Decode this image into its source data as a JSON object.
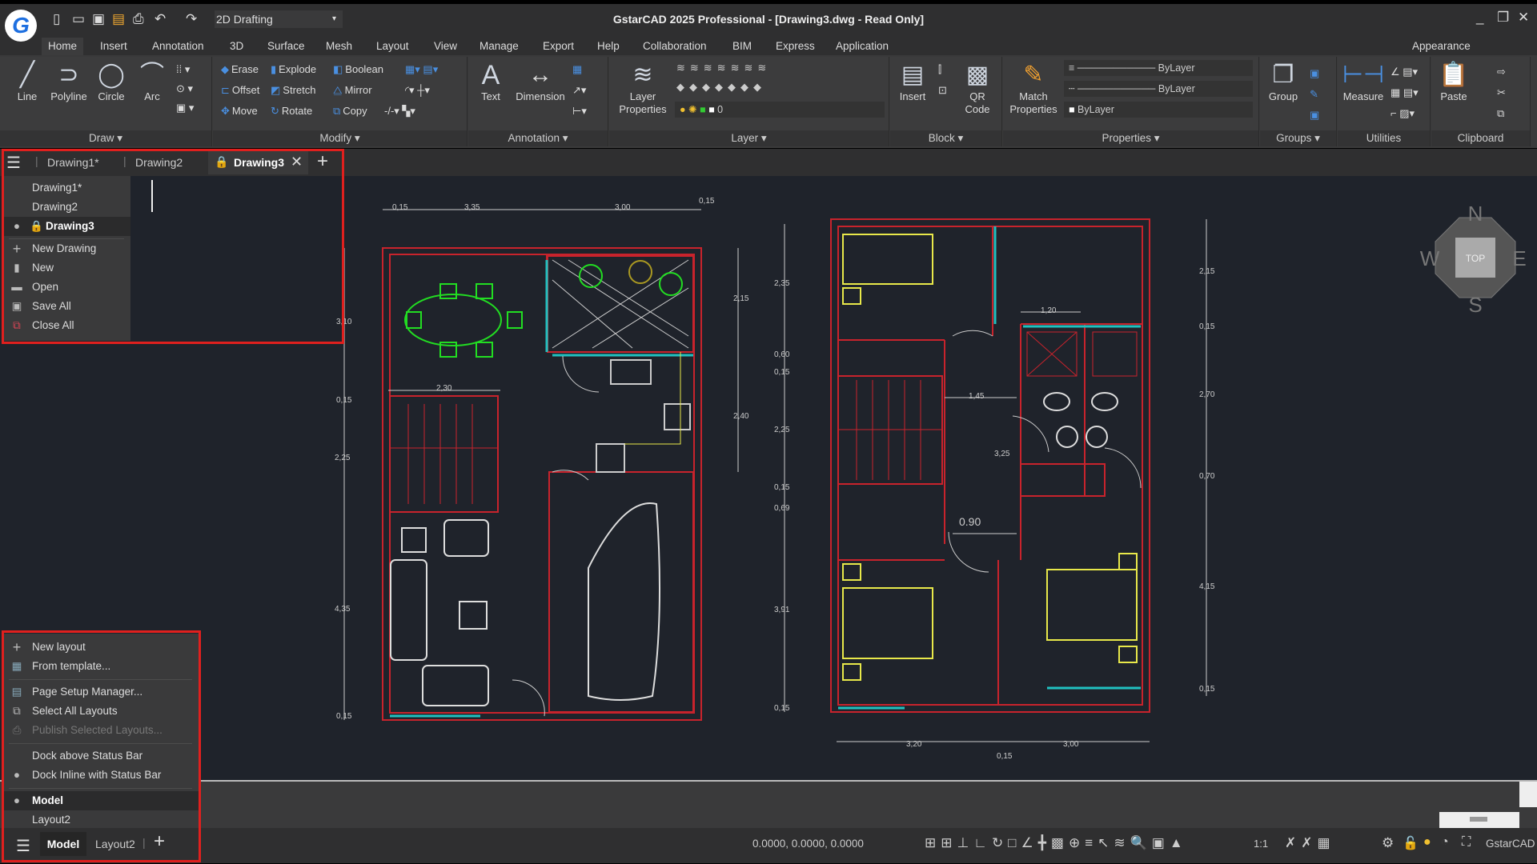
{
  "app": {
    "title": "GstarCAD 2025 Professional - [Drawing3.dwg - Read Only]",
    "logo": "G",
    "workspace": "2D Drafting"
  },
  "menubar": [
    "Home",
    "Insert",
    "Annotation",
    "3D",
    "Surface",
    "Mesh",
    "Layout",
    "View",
    "Manage",
    "Export",
    "Help",
    "Collaboration",
    "BIM",
    "Express",
    "Application"
  ],
  "appearance": "Appearance",
  "ribbon": {
    "draw": {
      "label": "Draw",
      "buttons": [
        "Line",
        "Polyline",
        "Circle",
        "Arc"
      ]
    },
    "modify": {
      "label": "Modify",
      "buttons": [
        "Erase",
        "Explode",
        "Boolean",
        "Offset",
        "Stretch",
        "Mirror",
        "Move",
        "Rotate",
        "Copy"
      ]
    },
    "annotation": {
      "label": "Annotation",
      "buttons": [
        "Text",
        "Dimension"
      ]
    },
    "layer": {
      "label": "Layer",
      "button": "Layer Properties",
      "current_layer": "0"
    },
    "block": {
      "label": "Block",
      "buttons": [
        "Insert",
        "QR Code"
      ]
    },
    "properties": {
      "label": "Properties",
      "button": "Match Properties",
      "linetype": "ByLayer",
      "lineweight": "ByLayer",
      "color": "ByLayer"
    },
    "groups": {
      "label": "Groups",
      "button": "Group"
    },
    "utilities": {
      "label": "Utilities",
      "button": "Measure"
    },
    "clipboard": {
      "label": "Clipboard",
      "button": "Paste"
    }
  },
  "doc_tabs": {
    "tabs": [
      "Drawing1*",
      "Drawing2",
      "Drawing3"
    ],
    "active": "Drawing3"
  },
  "doc_menu": {
    "drawings": [
      "Drawing1*",
      "Drawing2",
      "Drawing3"
    ],
    "actions": [
      "New Drawing",
      "New",
      "Open",
      "Save All",
      "Close All"
    ]
  },
  "layout_menu": {
    "items": [
      "New layout",
      "From template...",
      "Page Setup Manager...",
      "Select All Layouts",
      "Publish Selected Layouts...",
      "Dock above Status Bar",
      "Dock Inline with Status Bar"
    ],
    "layouts": [
      "Model",
      "Layout2"
    ]
  },
  "layout_tabs": {
    "tabs": [
      "Model",
      "Layout2"
    ],
    "active": "Model"
  },
  "status": {
    "coordinates": "0.0000, 0.0000, 0.0000",
    "scale": "1:1",
    "product": "GstarCAD"
  },
  "viewcube": {
    "top": "TOP",
    "n": "N",
    "s": "S",
    "e": "E",
    "w": "W"
  },
  "dimensions": {
    "l_top": [
      "0,15",
      "3,35",
      "3,00",
      "0,15"
    ],
    "l_left": [
      "3,10",
      "0,15",
      "2,25",
      "4,35",
      "0,15"
    ],
    "l_right": [
      "2,15",
      "2,40",
      "2,30"
    ],
    "r_mid": [
      "2,35",
      "0,60",
      "0,15",
      "2,25",
      "0,15",
      "0,69",
      "3,91",
      "0,15"
    ],
    "r_right": [
      "2,15",
      "0,15",
      "2,70",
      "0,70",
      "4,15",
      "0,15"
    ],
    "r_inner": [
      "1,20",
      "1,45",
      "3,25",
      "0.90"
    ],
    "r_bottom": [
      "3,20",
      "3,00",
      "0,15"
    ]
  },
  "colors": {
    "accent": "#4a90e2",
    "highlight_box": "#e0201e",
    "walls": "#c8232c",
    "furniture": "#e8e84a",
    "plants": "#22dd22",
    "glass": "#20c0c0"
  }
}
